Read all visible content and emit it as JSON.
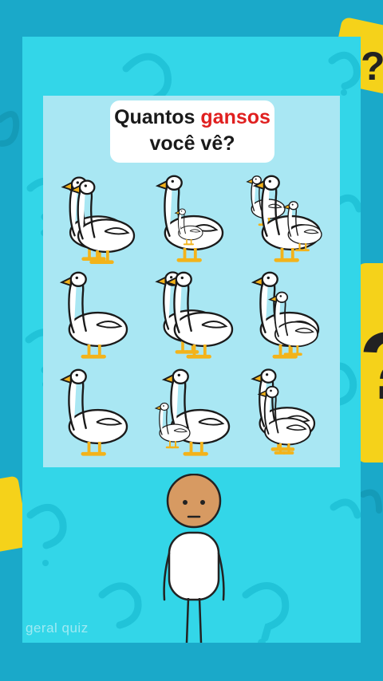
{
  "title": {
    "part1": "Quantos ",
    "highlight": "gansos",
    "part2": "você vê?"
  },
  "watermark": "geral quiz",
  "colors": {
    "background": "#1aa9c9",
    "frame": "#33d6e8",
    "panel": "#a9e7f3",
    "highlight": "#e01f1f",
    "sticky_note": "#f5d21a",
    "goose_beak": "#f3b31a"
  },
  "goose_cells": [
    {
      "layout": "two-overlapping"
    },
    {
      "layout": "big-and-small"
    },
    {
      "layout": "three"
    },
    {
      "layout": "single"
    },
    {
      "layout": "two-side-by-side"
    },
    {
      "layout": "big-and-medium"
    },
    {
      "layout": "single"
    },
    {
      "layout": "big-and-small-left"
    },
    {
      "layout": "two-stacked"
    }
  ],
  "icons": [
    "question-mark-icon",
    "goose-icon",
    "person-icon"
  ]
}
